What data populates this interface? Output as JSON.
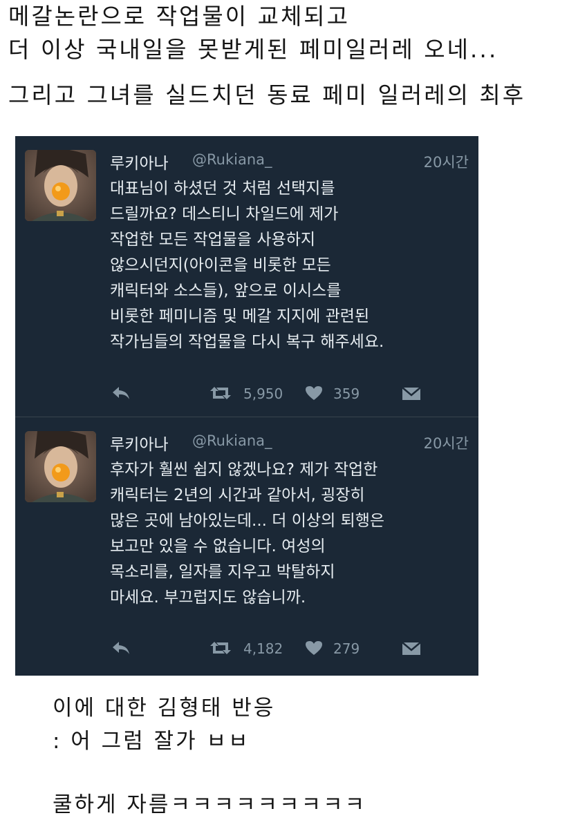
{
  "intro": {
    "line1": "메갈논란으로 작업물이 교체되고",
    "line2": "더 이상 국내일을 못받게된 페미일러레 오네...",
    "line3": "그리고 그녀를 실드치던 동료 페미 일러레의 최후"
  },
  "tweets": [
    {
      "name": "루키아나",
      "handle": "@Rukiana_",
      "time": "20시간",
      "lines": [
        "대표님이 하셨던 것 처럼 선택지를",
        "드릴까요? 데스티니 차일드에 제가",
        "작업한 모든 작업물을 사용하지",
        "않으시던지(아이콘을 비롯한 모든",
        "캐릭터와 소스들), 앞으로 이시스를",
        "비롯한 페미니즘 및 메갈 지지에 관련된",
        "작가님들의 작업물을 다시 복구 해주세요."
      ],
      "retweets": "5,950",
      "likes": "359"
    },
    {
      "name": "루키아나",
      "handle": "@Rukiana_",
      "time": "20시간",
      "lines": [
        "후자가 훨씬 쉽지 않겠나요? 제가 작업한",
        "캐릭터는 2년의 시간과 같아서, 굉장히",
        "많은 곳에 남아있는데... 더 이상의 퇴행은",
        "보고만 있을 수 없습니다. 여성의",
        "목소리를, 일자를 지우고 박탈하지",
        "마세요. 부끄럽지도 않습니까."
      ],
      "retweets": "4,182",
      "likes": "279"
    }
  ],
  "icons": {
    "reply": "reply-icon",
    "retweet": "retweet-icon",
    "like": "heart-icon",
    "message": "envelope-icon"
  },
  "outro": {
    "line1": "이에 대한 김형태 반응",
    "line2": ": 어 그럼 잘가 ㅂㅂ",
    "line3": "쿨하게 자름ㅋㅋㅋㅋㅋㅋㅋㅋㅋ"
  },
  "colors": {
    "tweet_background": "#1b2836",
    "text_primary": "#e6ecf0",
    "text_secondary": "#8899a6",
    "divider": "#38444d"
  }
}
